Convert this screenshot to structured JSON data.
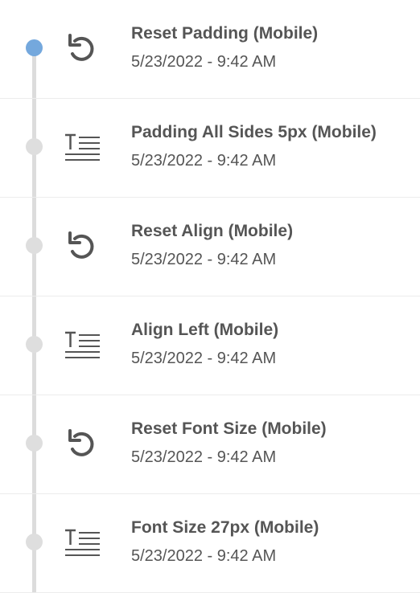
{
  "history": {
    "items": [
      {
        "title": "Reset Padding (Mobile)",
        "time": "5/23/2022 - 9:42 AM",
        "icon": "reset-icon",
        "active": true
      },
      {
        "title": "Padding All Sides 5px (Mobile)",
        "time": "5/23/2022 - 9:42 AM",
        "icon": "text-format-icon",
        "active": false
      },
      {
        "title": "Reset Align (Mobile)",
        "time": "5/23/2022 - 9:42 AM",
        "icon": "reset-icon",
        "active": false
      },
      {
        "title": "Align Left (Mobile)",
        "time": "5/23/2022 - 9:42 AM",
        "icon": "text-format-icon",
        "active": false
      },
      {
        "title": "Reset Font Size (Mobile)",
        "time": "5/23/2022 - 9:42 AM",
        "icon": "reset-icon",
        "active": false
      },
      {
        "title": "Font Size 27px (Mobile)",
        "time": "5/23/2022 - 9:42 AM",
        "icon": "text-format-icon",
        "active": false
      }
    ]
  },
  "colors": {
    "active_dot": "#74a8dd",
    "inactive_dot": "#dedede",
    "timeline": "#dcdcdc",
    "text": "#555555",
    "divider": "#ececec"
  }
}
